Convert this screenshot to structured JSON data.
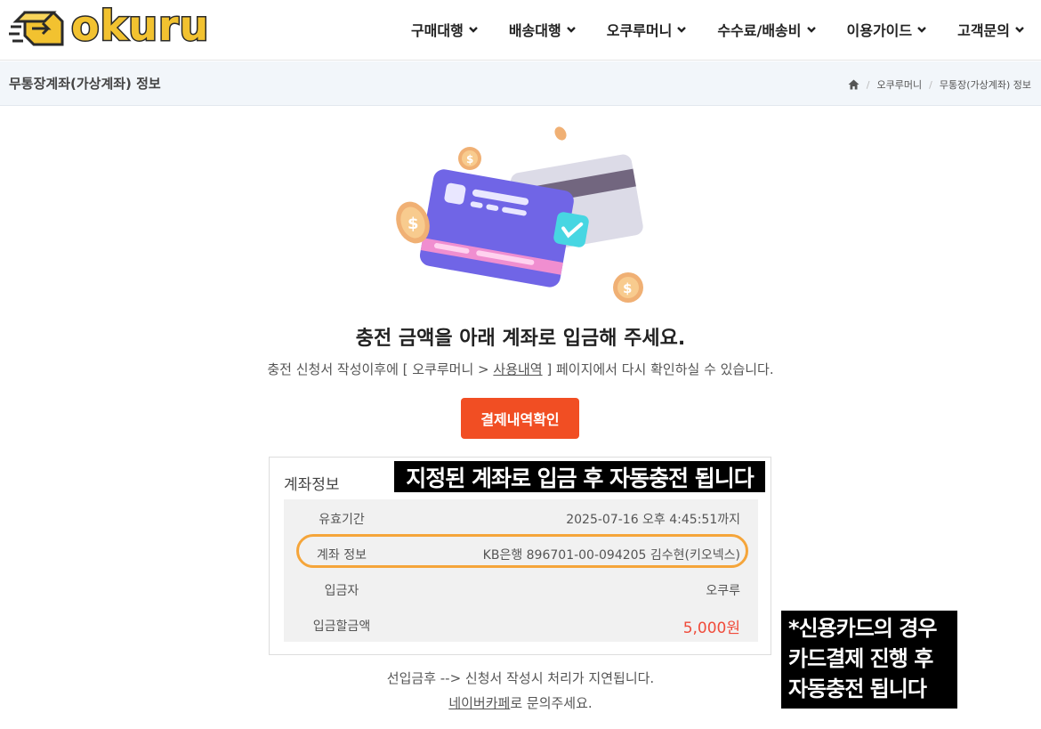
{
  "brand": {
    "name": "okuru",
    "accent": "#f2c230"
  },
  "nav": {
    "items": [
      {
        "label": "구매대행",
        "icon": "chevron-down-icon"
      },
      {
        "label": "배송대행",
        "icon": "chevron-down-icon"
      },
      {
        "label": "오쿠루머니",
        "icon": "chevron-down-icon"
      },
      {
        "label": "수수료/배송비",
        "icon": "chevron-down-icon"
      },
      {
        "label": "이용가이드",
        "icon": "chevron-down-icon"
      },
      {
        "label": "고객문의",
        "icon": "chevron-down-icon"
      }
    ]
  },
  "subheader": {
    "title": "무통장계좌(가상계좌) 정보",
    "breadcrumb": {
      "home_icon": "home-icon",
      "items": [
        "오쿠루머니",
        "무통장(가상계좌) 정보"
      ]
    }
  },
  "main": {
    "headline": "충전 금액을 아래 계좌로 입금해 주세요.",
    "subline_prefix": "충전 신청서 작성이후에 [ 오쿠루머니 > ",
    "subline_link": "사용내역",
    "subline_suffix": " ] 페이지에서 다시 확인하실 수 있습니다.",
    "confirm_button": "결제내역확인",
    "button_color": "#f14e23"
  },
  "account": {
    "title": "계좌정보",
    "rows": [
      {
        "label": "유효기간",
        "value": "2025-07-16 오후 4:45:51까지"
      },
      {
        "label": "계좌 정보",
        "value": "KB은행 896701-00-094205 김수현(키오넥스)"
      },
      {
        "label": "입금자",
        "value": "오쿠루"
      },
      {
        "label": "입금할금액",
        "value": "5,000원"
      }
    ],
    "amount_color": "#f04b3a"
  },
  "callouts": {
    "top": "지정된 계좌로 입금 후 자동충전 됩니다",
    "right_lines": [
      "*신용카드의 경우",
      "카드결제 진행 후",
      "자동충전 됩니다"
    ]
  },
  "footer": {
    "note": "선입금후 --> 신청서 작성시 처리가 지연됩니다.",
    "cafe_link": "네이버카페",
    "cafe_suffix": "로 문의주세요."
  }
}
